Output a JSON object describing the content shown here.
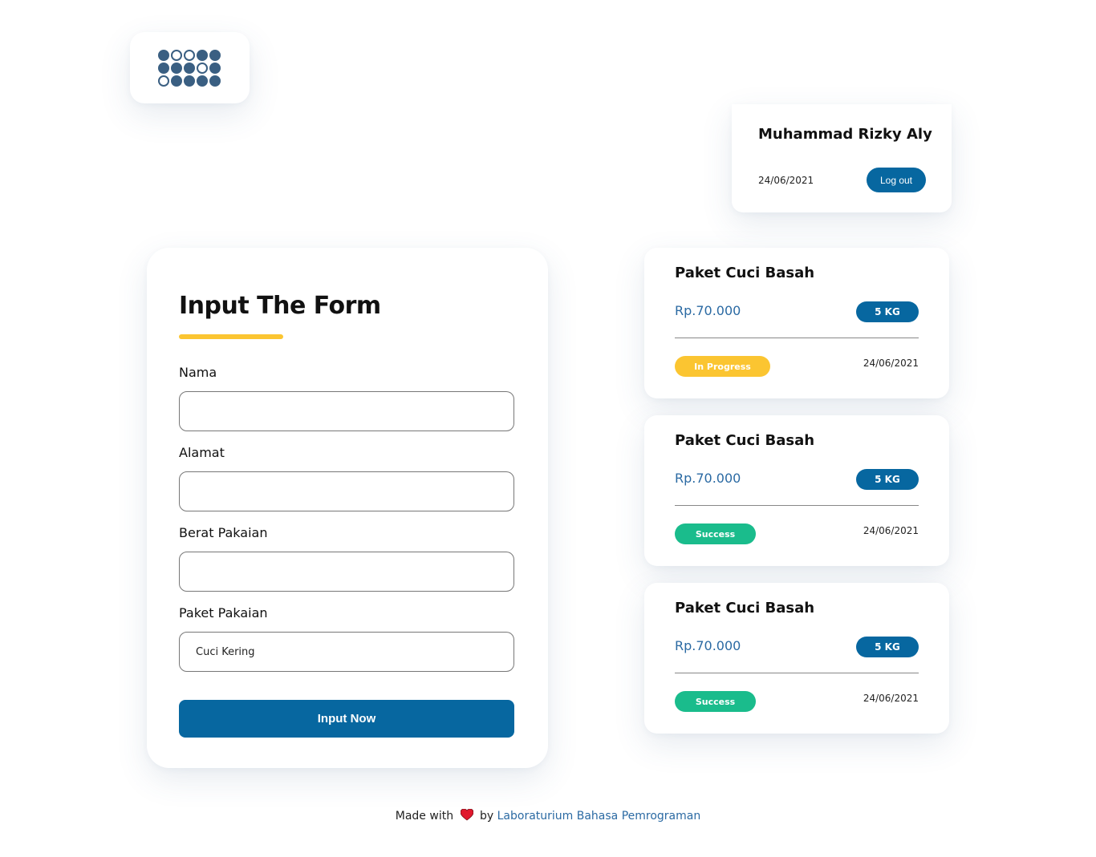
{
  "user": {
    "name": "Muhammad Rizky Aly",
    "date": "24/06/2021",
    "logout_label": "Log out"
  },
  "form": {
    "title": "Input The Form",
    "fields": [
      {
        "label": "Nama",
        "value": ""
      },
      {
        "label": "Alamat",
        "value": ""
      },
      {
        "label": "Berat Pakaian",
        "value": ""
      },
      {
        "label": "Paket Pakaian",
        "value": "Cuci Kering"
      }
    ],
    "submit_label": "Input Now"
  },
  "orders": [
    {
      "title": "Paket Cuci Basah",
      "price": "Rp.70.000",
      "weight": "5 KG",
      "status": "In Progress",
      "status_color": "#fbc531",
      "date": "24/06/2021"
    },
    {
      "title": "Paket Cuci Basah",
      "price": "Rp.70.000",
      "weight": "5 KG",
      "status": "Success",
      "status_color": "#1abc8c",
      "date": "24/06/2021"
    },
    {
      "title": "Paket Cuci Basah",
      "price": "Rp.70.000",
      "weight": "5 KG",
      "status": "Success",
      "status_color": "#1abc8c",
      "date": "24/06/2021"
    }
  ],
  "footer": {
    "made_with": "Made with",
    "by": "by",
    "link_text": "Laboraturium Bahasa Pemrograman",
    "heart_icon": "heart-icon"
  },
  "colors": {
    "primary": "#0767a0",
    "accent_yellow": "#fbc531",
    "success_green": "#1abc8c",
    "link_blue": "#2b6aa3",
    "logo_dot": "#3a5f82"
  }
}
